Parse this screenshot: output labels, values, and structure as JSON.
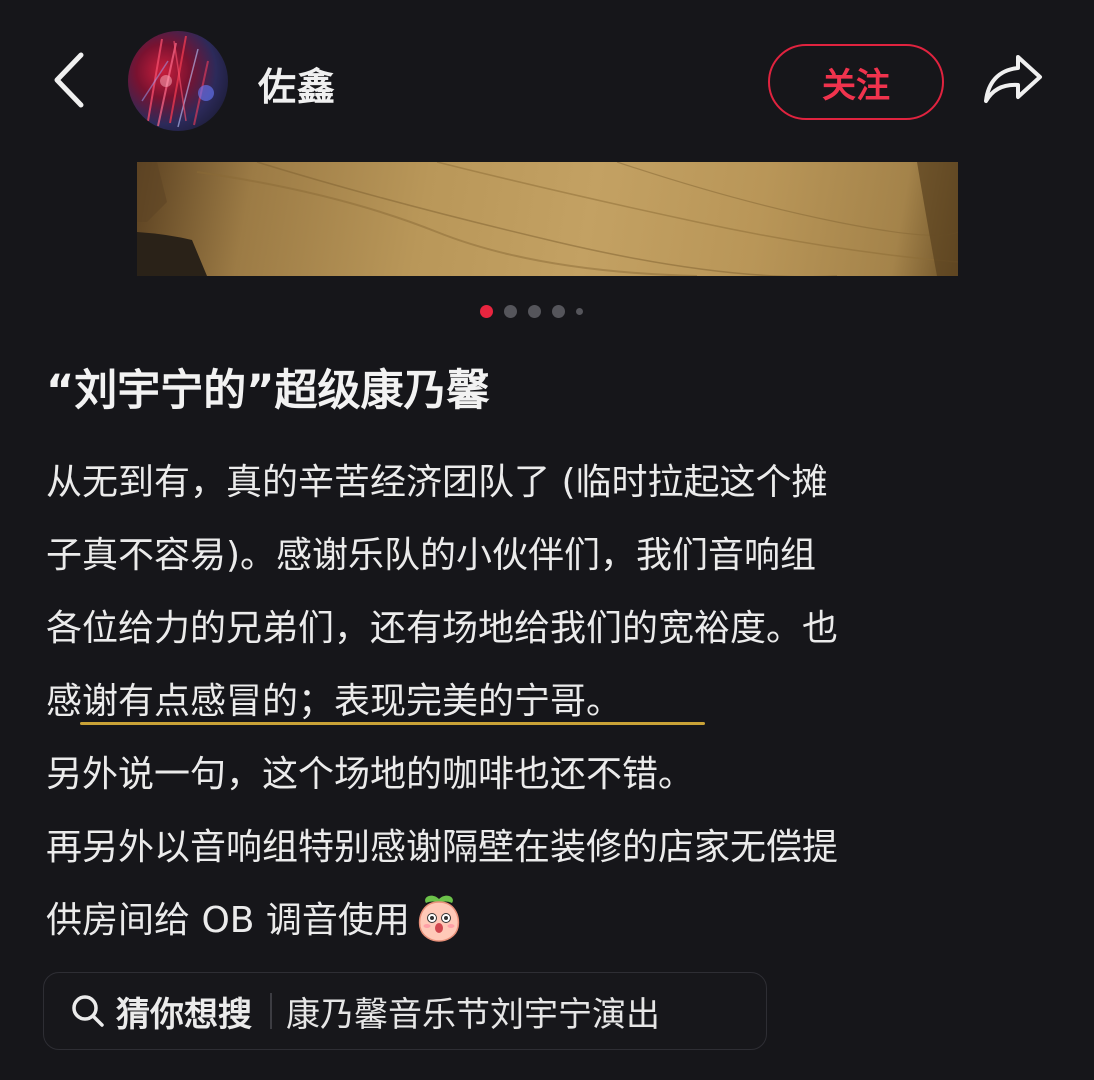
{
  "header": {
    "back_icon": "chevron-left-icon",
    "username": "佐鑫",
    "follow_label": "关注",
    "share_icon": "share-arrow-icon",
    "accent_color": "#e0233f"
  },
  "carousel": {
    "total": 5,
    "active_index": 0
  },
  "post": {
    "title": "“刘宇宁的”超级康乃馨",
    "lines": [
      "从无到有，真的辛苦经济团队了 (临时拉起这个摊",
      "子真不容易)。感谢乐队的小伙伴们，我们音响组",
      "各位给力的兄弟们，还有场地给我们的宽裕度。也",
      "感谢有点感冒的；表现完美的宁哥。",
      "另外说一句，这个场地的咖啡也还不错。",
      "再另外以音响组特别感谢隔壁在装修的店家无偿提",
      "供房间给 OB 调音使用"
    ],
    "emoji_icon": "peach-face-emoji-icon"
  },
  "search": {
    "icon": "search-icon",
    "label": "猜你想搜",
    "query": "康乃馨音乐节刘宇宁演出"
  }
}
